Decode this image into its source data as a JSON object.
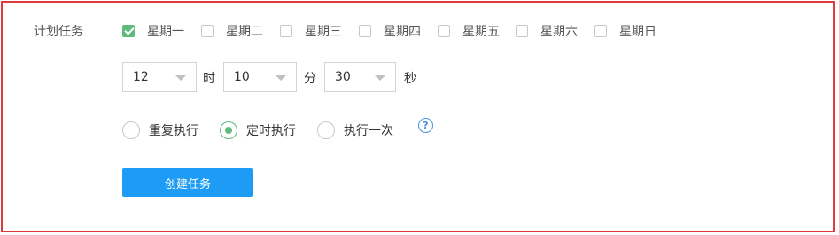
{
  "section_label": "计划任务",
  "weekdays": [
    {
      "label": "星期一",
      "checked": true
    },
    {
      "label": "星期二",
      "checked": false
    },
    {
      "label": "星期三",
      "checked": false
    },
    {
      "label": "星期四",
      "checked": false
    },
    {
      "label": "星期五",
      "checked": false
    },
    {
      "label": "星期六",
      "checked": false
    },
    {
      "label": "星期日",
      "checked": false
    }
  ],
  "time": {
    "hour": "12",
    "hour_unit": "时",
    "minute": "10",
    "minute_unit": "分",
    "second": "30",
    "second_unit": "秒"
  },
  "modes": [
    {
      "label": "重复执行",
      "selected": false
    },
    {
      "label": "定时执行",
      "selected": true
    },
    {
      "label": "执行一次",
      "selected": false
    }
  ],
  "help_icon_glyph": "?",
  "create_button": "创建任务",
  "colors": {
    "border": "#e03b3b",
    "check_green": "#5fba7d",
    "button_blue": "#1e9cf5",
    "help_blue": "#4a90e2"
  }
}
